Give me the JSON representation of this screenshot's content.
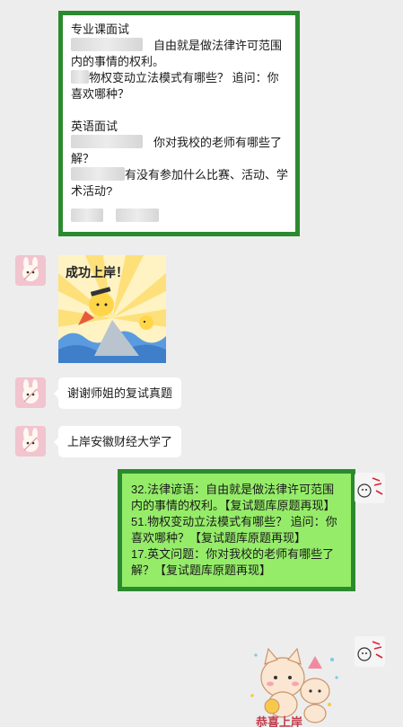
{
  "top_card": {
    "partial_header": "····",
    "section_professional": "专业课面试",
    "q1_text": "自由就是做法律许可范围内的事情的权利。",
    "q2_text": "物权变动立法模式有哪些？ 追问：你喜欢哪种？",
    "section_english": "英语面试",
    "q3_text": "你对我校的老师有哪些了解？",
    "q4_text": "有没有参加什么比赛、活动、学术活动?"
  },
  "sticker": {
    "caption": "成功上岸！",
    "colors": {
      "bg": "#fff3c4",
      "rays": "#fde07a",
      "wave": "#5a9be0"
    }
  },
  "messages": [
    {
      "text": "谢谢师姐的复试真题"
    },
    {
      "text": "上岸安徽财经大学了"
    }
  ],
  "reply_card": {
    "line1": "32.法律谚语：自由就是做法律许可范围内的事情的权利。【复试题库原题再现】",
    "line2": "51.物权变动立法模式有哪些？ 追问：你喜欢哪种？【复试题库原题再现】",
    "line3": "17.英文问题：你对我校的老师有哪些了解？【复试题库原题再现】"
  },
  "bottom_sticker": {
    "caption": "恭喜上岸"
  },
  "colors": {
    "accent_green": "#2c8a2e",
    "bubble_green": "#95ec69",
    "background": "#ededed"
  }
}
